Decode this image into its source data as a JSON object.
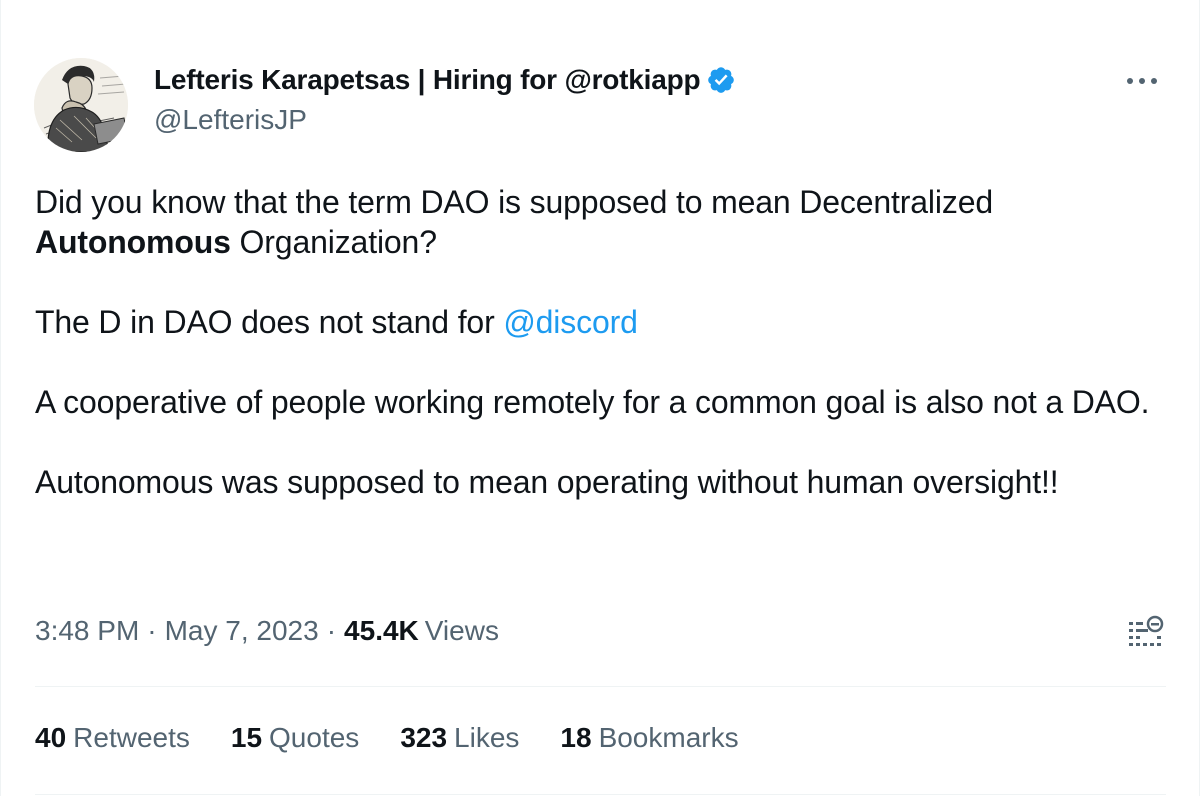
{
  "author": {
    "display_name": "Lefteris Karapetsas | Hiring for @rotkiapp",
    "handle": "@LefterisJP",
    "avatar_icon": "sketch-portrait-avatar",
    "verified_icon": "verified-badge-icon",
    "verified_color": "#1d9bf0"
  },
  "tweet": {
    "p1_start": "Did you know that the term DAO is supposed to mean Decentralized ",
    "p1_bold": "Autonomous",
    "p1_end": " Organization?",
    "p2_start": "The D in DAO does not stand for ",
    "p2_mention": "@discord",
    "p3": "A cooperative of people working remotely for a common goal is also not a DAO.",
    "p4": "Autonomous was supposed to mean operating without human oversight!!"
  },
  "meta": {
    "time": "3:48 PM",
    "separator": "·",
    "date": "May 7, 2023",
    "views_count": "45.4K",
    "views_label": "Views"
  },
  "stats": {
    "retweets": {
      "count": "40",
      "label": "Retweets"
    },
    "quotes": {
      "count": "15",
      "label": "Quotes"
    },
    "likes": {
      "count": "323",
      "label": "Likes"
    },
    "bookmarks": {
      "count": "18",
      "label": "Bookmarks"
    }
  },
  "icons": {
    "more": "more-dots-icon",
    "analytics": "analytics-icon"
  },
  "colors": {
    "text": "#0f1419",
    "secondary": "#536471",
    "link": "#1d9bf0",
    "divider": "#eff3f4"
  }
}
